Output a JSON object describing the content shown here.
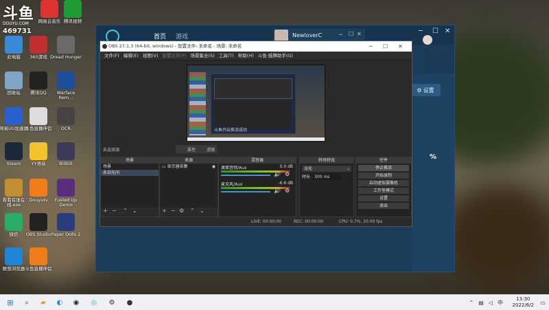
{
  "watermark": {
    "logo": "斗鱼",
    "sub": "DOUYU.COM",
    "room": "469731"
  },
  "desktop_icons": [
    {
      "label": "此电脑",
      "icon": "computer-icon",
      "color": "#3a8ad8"
    },
    {
      "label": "360游戏",
      "icon": "game-icon",
      "color": "#c03030"
    },
    {
      "label": "Dread Hunger",
      "icon": "anchor-icon",
      "color": "#6a6a6a"
    },
    {
      "label": "回收站",
      "icon": "recycle-bin-icon",
      "color": "#7fa6c8"
    },
    {
      "label": "腾讯QQ",
      "icon": "qq-icon",
      "color": "#222"
    },
    {
      "label": "Warface Rem...",
      "icon": "warface-icon",
      "color": "#1d4f9a"
    },
    {
      "label": "网易UU加速器",
      "icon": "uu-icon",
      "color": "#2a5fd0"
    },
    {
      "label": "斗鱼直播伴侣",
      "icon": "file-icon",
      "color": "#ddd"
    },
    {
      "label": "OCR",
      "icon": "ocr-icon",
      "color": "#444"
    },
    {
      "label": "Steam",
      "icon": "steam-icon",
      "color": "#1b2838"
    },
    {
      "label": "YY语音",
      "icon": "yy-icon",
      "color": "#f2c12e"
    },
    {
      "label": "Bilibili",
      "icon": "bilibili-icon",
      "color": "#3c3c5a"
    },
    {
      "label": "看看有谁在线.exe",
      "icon": "app-icon",
      "color": "#c48f33"
    },
    {
      "label": "Douyutv",
      "icon": "douyu-icon",
      "color": "#f07c1a"
    },
    {
      "label": "Fueled Up Demo",
      "icon": "fueled-icon",
      "color": "#5b2d7c"
    },
    {
      "label": "微信",
      "icon": "wechat-icon",
      "color": "#2aae67"
    },
    {
      "label": "OBS Studio",
      "icon": "obs-icon",
      "color": "#222"
    },
    {
      "label": "Paper Dolls 2",
      "icon": "paperdolls-icon",
      "color": "#2a3d7a"
    },
    {
      "label": "联想浏览器",
      "icon": "browser-icon",
      "color": "#1f86d6"
    },
    {
      "label": "斗鱼直播伴侣",
      "icon": "douyu-icon",
      "color": "#f07c1a"
    },
    {
      "label": "网易云音乐",
      "icon": "music-icon",
      "color": "#d33"
    },
    {
      "label": "腾讯视频",
      "icon": "video-icon",
      "color": "#1f9b35"
    }
  ],
  "douyu_window": {
    "tabs": [
      "首页",
      "游戏"
    ],
    "user_name": "NewloverC",
    "settings_button": "设置",
    "percent": "%"
  },
  "obs": {
    "title": "OBS 27.1.3 (64-bit, windows) - 配置文件: 未命名 - 场景: 未命名",
    "menu": [
      "文件(F)",
      "编辑(E)",
      "视图(V)",
      "配置文件(P)",
      "场景集合(S)",
      "工具(T)",
      "帮助(H)",
      "斗鱼·鼓舞助手(G)"
    ],
    "preview_status": "斗鱼开启推流成功",
    "source_bar": {
      "no_source": "未选择源",
      "properties": "属性",
      "filters": "滤镜"
    },
    "docks": {
      "scenes": {
        "title": "场景",
        "items": [
          "场景",
          "永劫无间"
        ]
      },
      "sources": {
        "title": "来源",
        "items": [
          "显示器采集"
        ]
      },
      "mixer": {
        "title": "混音器",
        "channels": [
          {
            "name": "桌面音频/Aux",
            "db": "0.0 dB"
          },
          {
            "name": "麦克风/Aux",
            "db": "-6.6 dB"
          }
        ]
      },
      "transitions": {
        "title": "转场特效",
        "type": "淡化",
        "duration_label": "时长",
        "duration": "300 ms"
      },
      "controls": {
        "title": "控件",
        "buttons": [
          "停止推流",
          "开始录制",
          "启动虚拟摄像机",
          "工作室模式",
          "设置",
          "退出"
        ]
      }
    },
    "status": {
      "live": "LIVE: 00:00:00",
      "rec": "REC: 00:00:00",
      "cpu": "CPU: 0.7%, 30.00 fps"
    }
  },
  "taskbar": {
    "time": "13:30",
    "date": "2022/6/2",
    "lang": "中"
  }
}
